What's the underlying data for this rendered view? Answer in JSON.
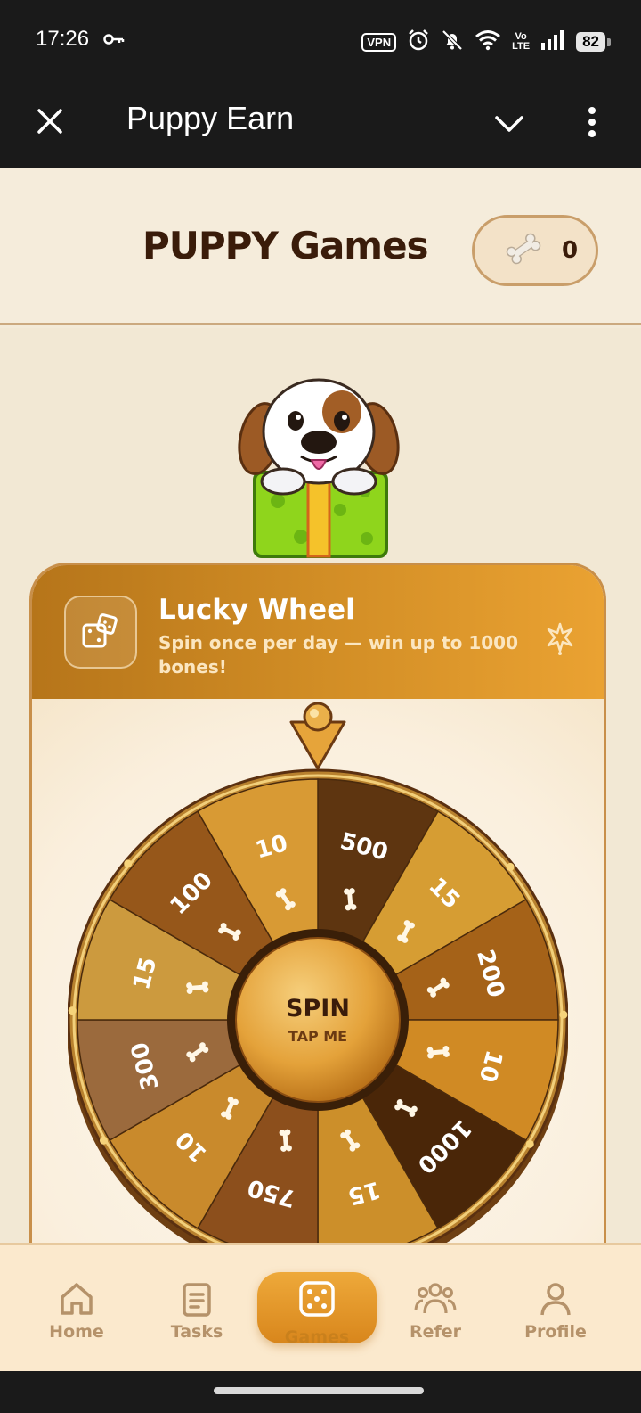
{
  "status_bar": {
    "time": "17:26",
    "vpn": "VPN",
    "volte_top": "Vo",
    "volte_bottom": "LTE",
    "battery": "82",
    "icons": [
      "key-icon",
      "vpn-icon",
      "alarm-icon",
      "bell-off-icon",
      "wifi-icon",
      "volte-icon",
      "signal-icon",
      "battery-icon"
    ]
  },
  "app_bar": {
    "title": "Puppy Earn",
    "icons": [
      "close-icon",
      "chevron-down-icon",
      "more-vert-icon"
    ]
  },
  "header": {
    "title": "PUPPY Games",
    "bone_count": "0",
    "icons": [
      "bone-icon"
    ]
  },
  "lucky_wheel": {
    "title": "Lucky Wheel",
    "description": "Spin once per day — win up to 1000 bones!",
    "spin_label": "SPIN",
    "spin_sub": "TAP ME",
    "segments": [
      "500",
      "15",
      "200",
      "10",
      "1000",
      "15",
      "750",
      "10",
      "300",
      "15",
      "100",
      "10"
    ],
    "icons": [
      "dice-icon",
      "sparkle-icon",
      "pointer-icon",
      "bone-icon"
    ],
    "colors": {
      "accent": "#d18d25",
      "dark_brown": "#3a1c0a"
    }
  },
  "bottom_nav": {
    "items": [
      {
        "label": "Home",
        "icon": "home-icon"
      },
      {
        "label": "Tasks",
        "icon": "clipboard-icon"
      },
      {
        "label": "Games",
        "icon": "dice-icon"
      },
      {
        "label": "Refer",
        "icon": "users-icon"
      },
      {
        "label": "Profile",
        "icon": "user-icon"
      }
    ],
    "active": "Games"
  }
}
